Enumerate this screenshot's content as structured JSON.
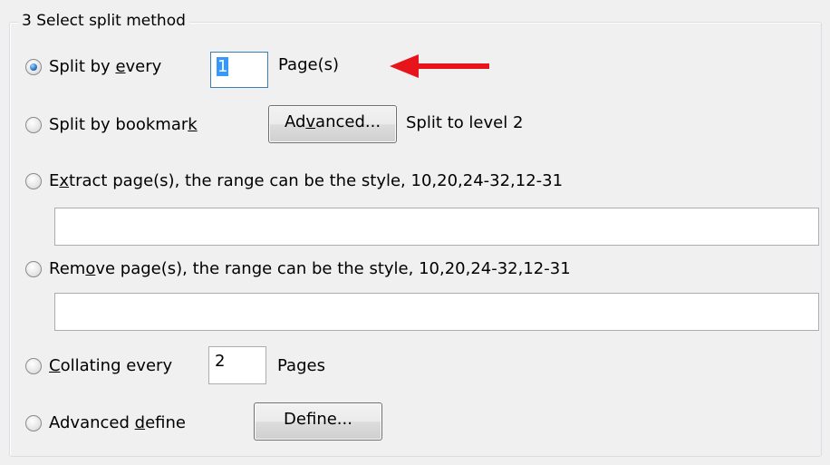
{
  "group": {
    "title": "3 Select split method"
  },
  "options": {
    "split_every": {
      "pre": "Split by ",
      "accel": "e",
      "post": "very",
      "value": "1",
      "unit": "Page(s)",
      "checked": true
    },
    "split_bookmark": {
      "pre": "Split by bookmar",
      "accel": "k",
      "post": "",
      "button_pre": "Ad",
      "button_accel": "v",
      "button_post": "anced...",
      "note": "Split to level 2"
    },
    "extract": {
      "pre": "E",
      "accel": "x",
      "post": "tract page(s), the range can be the style, 10,20,24-32,12-31",
      "value": ""
    },
    "remove": {
      "pre": "Rem",
      "accel": "o",
      "post": "ve page(s), the range can be the style, 10,20,24-32,12-31",
      "value": ""
    },
    "collating": {
      "pre": "",
      "accel": "C",
      "post": "ollating every",
      "value": "2",
      "unit": "Pages"
    },
    "advanced": {
      "pre": "Advanced ",
      "accel": "d",
      "post": "efine",
      "button_pre": "Def",
      "button_accel": "i",
      "button_post": "ne..."
    }
  },
  "annotation": {
    "arrow_color": "#e8141b",
    "arrow_icon": "left-arrow-icon"
  }
}
